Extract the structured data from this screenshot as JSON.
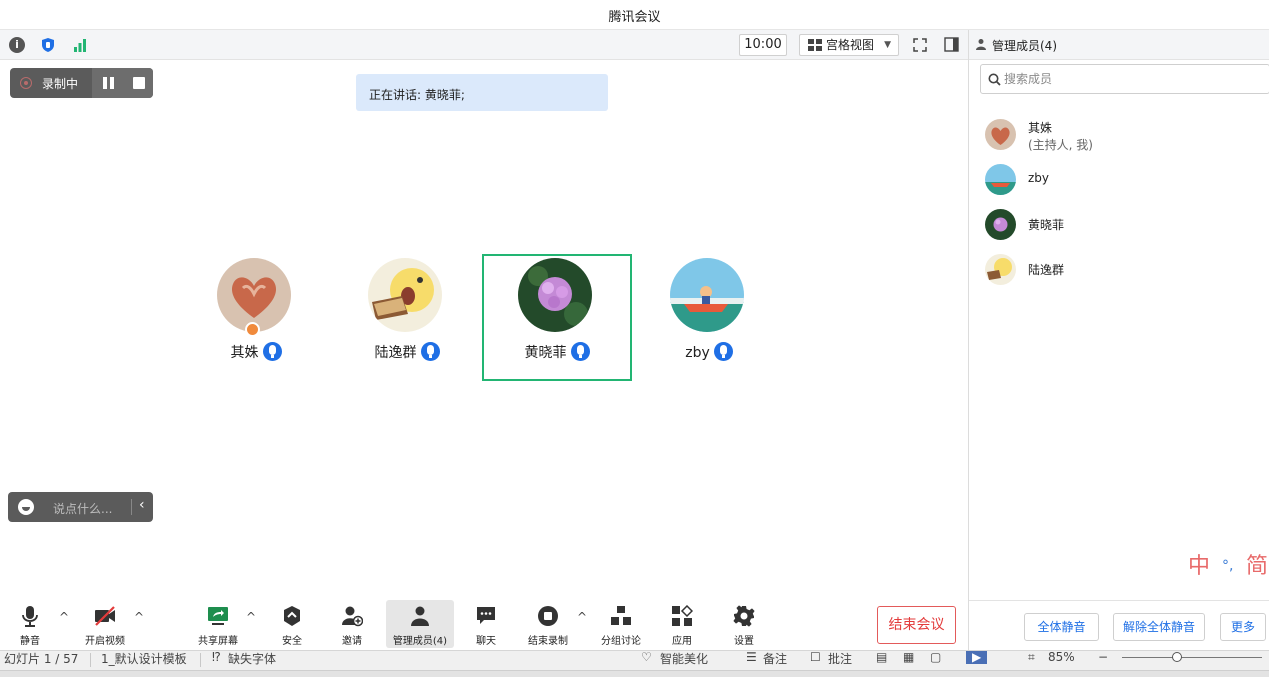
{
  "window": {
    "title": "腾讯会议"
  },
  "toolbar": {
    "time": "10:00",
    "view_label": "宫格视图",
    "icons": [
      "info-icon",
      "shield-icon",
      "signal-icon",
      "fullscreen-icon",
      "sidebar-toggle-icon"
    ]
  },
  "recording": {
    "label": "录制中"
  },
  "speaking": {
    "text": "正在讲话: 黄晓菲;"
  },
  "participants": [
    {
      "name": "其姝",
      "avatar": "heart-hands-avatar",
      "is_host": true,
      "active": false
    },
    {
      "name": "陆逸群",
      "avatar": "cartoon-chick-avatar",
      "is_host": false,
      "active": false
    },
    {
      "name": "黄晓菲",
      "avatar": "flower-avatar",
      "is_host": false,
      "active": true
    },
    {
      "name": "zby",
      "avatar": "anime-scene-avatar",
      "is_host": false,
      "active": false
    }
  ],
  "chat": {
    "placeholder": "说点什么..."
  },
  "panel": {
    "title": "管理成员(4)",
    "search_placeholder": "搜索成员",
    "members": [
      {
        "name": "其姝",
        "role": "(主持人, 我)"
      },
      {
        "name": "zby",
        "role": ""
      },
      {
        "name": "黄晓菲",
        "role": ""
      },
      {
        "name": "陆逸群",
        "role": ""
      }
    ],
    "mute_all": "全体静音",
    "unmute_all": "解除全体静音",
    "more": "更多"
  },
  "ime": {
    "lang": "中",
    "punct": "°,",
    "mode": "简"
  },
  "bottom_toolbar": {
    "mute": "静音",
    "video": "开启视频",
    "share": "共享屏幕",
    "security": "安全",
    "invite": "邀请",
    "members": "管理成员(4)",
    "chat": "聊天",
    "end_recording": "结束录制",
    "breakout": "分组讨论",
    "apps": "应用",
    "settings": "设置",
    "end_meeting": "结束会议"
  },
  "ppt_status": {
    "slide": "幻灯片 1 / 57",
    "template": "1_默认设计模板",
    "missing_font": "缺失字体",
    "beautify": "智能美化",
    "notes": "备注",
    "comments": "批注",
    "zoom": "85%"
  },
  "colors": {
    "accent": "#1f6fe5",
    "active_border": "#22b573",
    "end_red": "#e33b3b"
  }
}
